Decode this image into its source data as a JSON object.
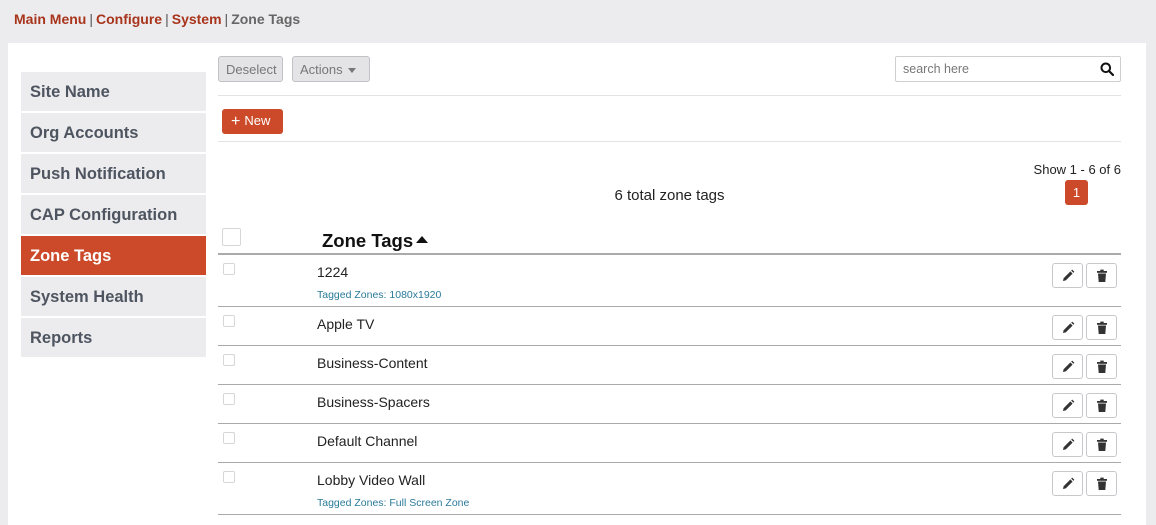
{
  "breadcrumb": {
    "items": [
      "Main Menu",
      "Configure",
      "System"
    ],
    "separator": "|",
    "current": "Zone Tags"
  },
  "sidebar": {
    "items": [
      {
        "label": "Site Name",
        "active": false
      },
      {
        "label": "Org Accounts",
        "active": false
      },
      {
        "label": "Push Notification",
        "active": false
      },
      {
        "label": "CAP Configuration",
        "active": false
      },
      {
        "label": "Zone Tags",
        "active": true
      },
      {
        "label": "System Health",
        "active": false
      },
      {
        "label": "Reports",
        "active": false
      }
    ]
  },
  "toolbar": {
    "deselect_label": "Deselect",
    "actions_label": "Actions",
    "search_placeholder": "search here",
    "search_value": ""
  },
  "new_button": {
    "label": "New"
  },
  "pagination": {
    "summary": "Show 1 - 6 of 6",
    "current_page": "1"
  },
  "table": {
    "total_text": "6 total zone tags",
    "column_header": "Zone Tags",
    "sort": "ascending",
    "tagged_prefix": "Tagged Zones:",
    "rows": [
      {
        "name": "1224",
        "tagged": "1080x1920"
      },
      {
        "name": "Apple TV",
        "tagged": ""
      },
      {
        "name": "Business-Content",
        "tagged": ""
      },
      {
        "name": "Business-Spacers",
        "tagged": ""
      },
      {
        "name": "Default Channel",
        "tagged": ""
      },
      {
        "name": "Lobby Video Wall",
        "tagged": "Full Screen Zone"
      }
    ]
  },
  "colors": {
    "accent": "#cc4a29",
    "breadcrumb_link": "#a8341c",
    "tagged_text": "#2b7a9a",
    "background": "#ececee"
  },
  "icons": {
    "search": "search-icon",
    "plus": "plus-icon",
    "caret": "caret-down-icon",
    "sort": "sort-asc-icon",
    "edit": "pencil-icon",
    "delete": "trash-icon"
  }
}
